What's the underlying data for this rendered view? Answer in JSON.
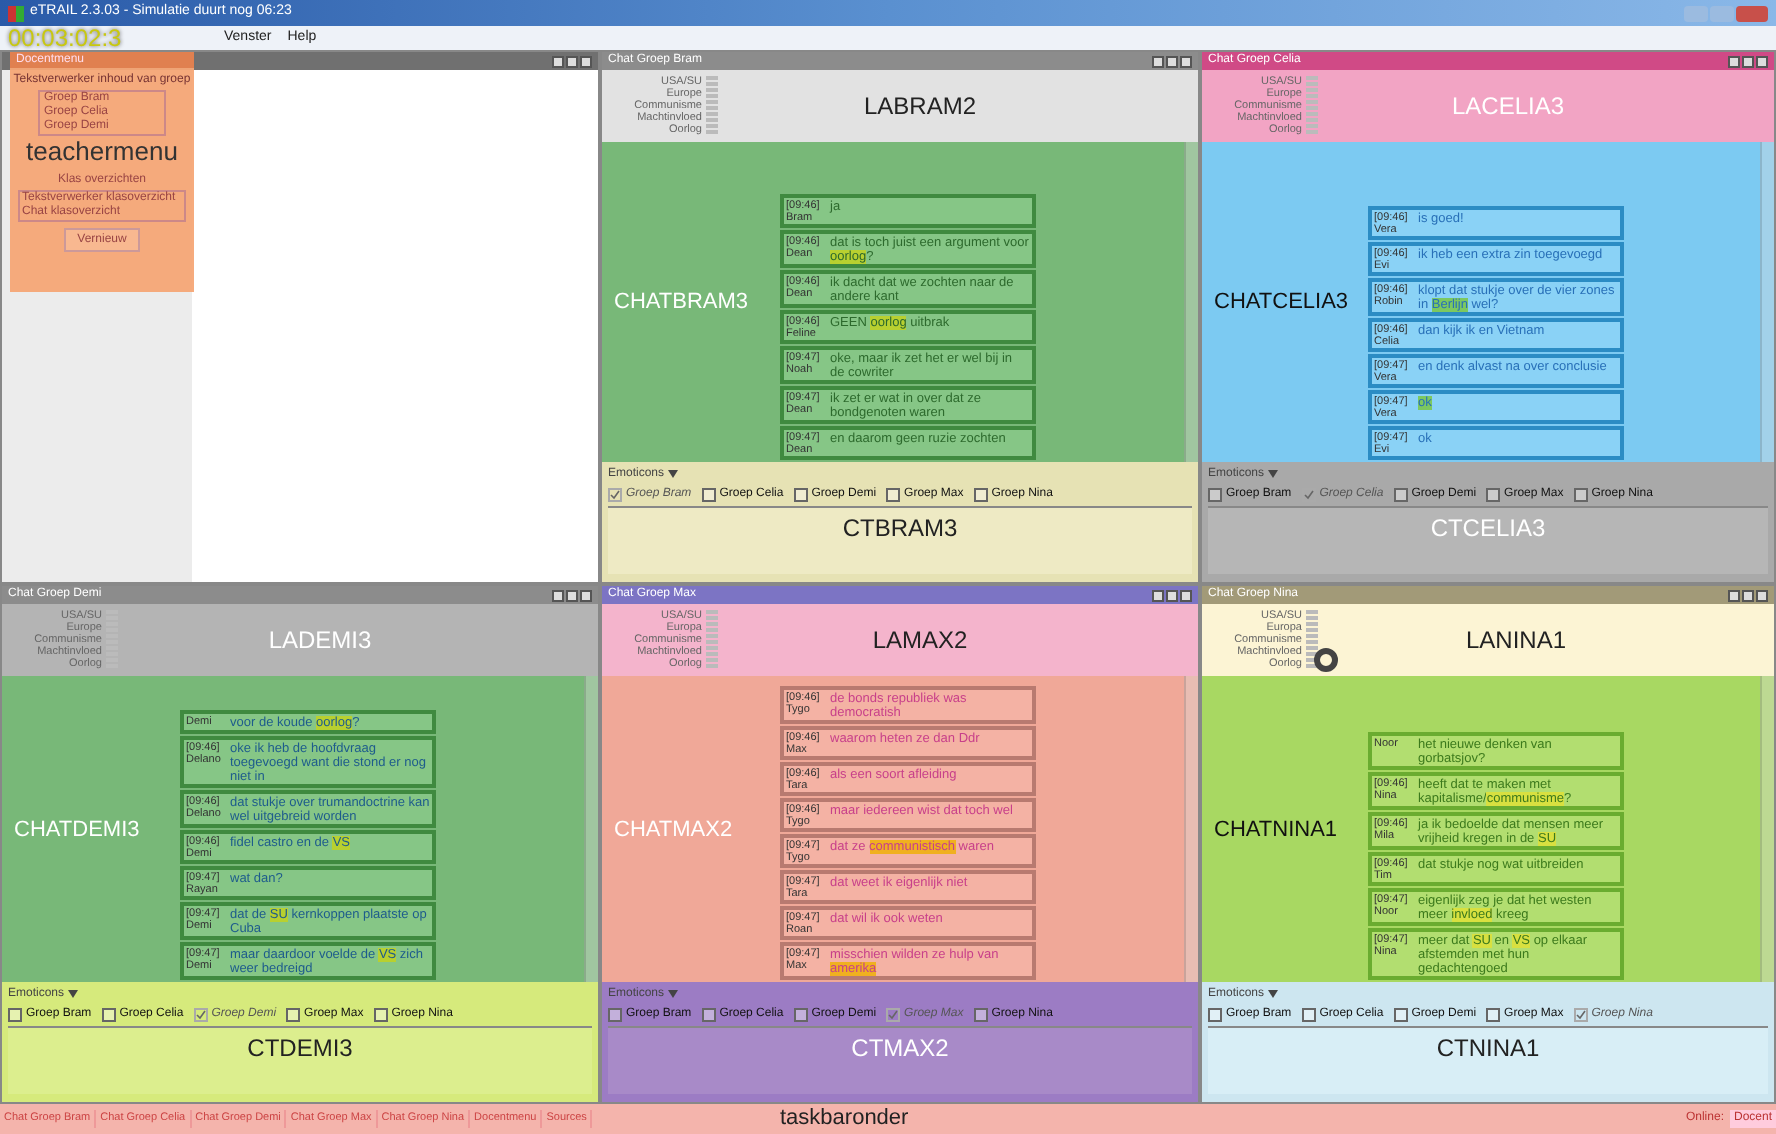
{
  "window": {
    "title": "eTRAIL 2.3.03 - Simulatie duurt nog 06:23"
  },
  "menu": [
    "Venster",
    "Help"
  ],
  "timer": "00:03:02:3",
  "docentmenu": {
    "title": "Docentmenu",
    "section_label": "Tekstverwerker inhoud van groep",
    "groups": [
      {
        "label": "Groep Bram",
        "selected": false
      },
      {
        "label": "Groep Celia",
        "selected": false
      },
      {
        "label": "Groep Demi",
        "selected": false
      }
    ],
    "overlay_label": "teachermenu",
    "overview_label": "Klas overzichten",
    "overviews": [
      {
        "label": "Tekstverwerker klasoverzicht",
        "selected": false
      },
      {
        "label": "Chat klasoverzicht",
        "selected": false
      }
    ],
    "button": "Vernieuw"
  },
  "chats": [
    {
      "title": "Chat Groep Bram",
      "la_label": "LABRAM2",
      "categories": [
        "USA/SU",
        "Europe",
        "Communisme",
        "Machtinvloed",
        "Oorlog"
      ],
      "chat_label": "CHATBRAM3",
      "input_label": "CTBRAM3",
      "emoticons": "Emoticons",
      "messages": [
        {
          "time": "[09:46]",
          "name": "Bram",
          "parts": [
            {
              "text": "ja",
              "highlight": false
            }
          ]
        },
        {
          "time": "[09:46]",
          "name": "Dean",
          "parts": [
            {
              "text": "dat is toch juist een argument voor ",
              "highlight": false
            },
            {
              "text": "oorlog",
              "highlight": true
            },
            {
              "text": "?",
              "highlight": false
            }
          ]
        },
        {
          "time": "[09:46]",
          "name": "Dean",
          "parts": [
            {
              "text": "ik dacht dat we zochten naar de andere kant",
              "highlight": false
            }
          ]
        },
        {
          "time": "[09:46]",
          "name": "Feline",
          "parts": [
            {
              "text": "GEEN ",
              "highlight": false
            },
            {
              "text": "oorlog",
              "highlight": true
            },
            {
              "text": " uitbrak",
              "highlight": false
            }
          ]
        },
        {
          "time": "[09:47]",
          "name": "Noah",
          "parts": [
            {
              "text": "oke, maar ik zet het er wel bij in de cowriter",
              "highlight": false
            }
          ]
        },
        {
          "time": "[09:47]",
          "name": "Dean",
          "parts": [
            {
              "text": "ik zet er wat in over dat ze bondgenoten waren",
              "highlight": false
            }
          ]
        },
        {
          "time": "[09:47]",
          "name": "Dean",
          "parts": [
            {
              "text": "en daarom geen ruzie zochten",
              "highlight": false
            }
          ]
        }
      ],
      "checkboxes": [
        {
          "label": "Groep Bram",
          "checked": true,
          "disabled": true
        },
        {
          "label": "Groep Celia",
          "checked": false,
          "disabled": false
        },
        {
          "label": "Groep Demi",
          "checked": false,
          "disabled": false
        },
        {
          "label": "Groep Max",
          "checked": false,
          "disabled": false
        },
        {
          "label": "Groep Nina",
          "checked": false,
          "disabled": false
        }
      ]
    },
    {
      "title": "Chat Groep Celia",
      "la_label": "LACELIA3",
      "categories": [
        "USA/SU",
        "Europe",
        "Communisme",
        "Machtinvloed",
        "Oorlog"
      ],
      "chat_label": "CHATCELIA3",
      "input_label": "CTCELIA3",
      "emoticons": "Emoticons",
      "messages": [
        {
          "time": "[09:46]",
          "name": "Vera",
          "parts": [
            {
              "text": "is goed!",
              "highlight": false
            }
          ]
        },
        {
          "time": "[09:46]",
          "name": "Evi",
          "parts": [
            {
              "text": "ik heb een extra zin toegevoegd",
              "highlight": false
            }
          ]
        },
        {
          "time": "[09:46]",
          "name": "Robin",
          "parts": [
            {
              "text": "klopt dat stukje over de vier zones in ",
              "highlight": false
            },
            {
              "text": "Berlijn",
              "highlight": true
            },
            {
              "text": " wel?",
              "highlight": false
            }
          ]
        },
        {
          "time": "[09:46]",
          "name": "Celia",
          "parts": [
            {
              "text": "dan kijk ik en Vietnam",
              "highlight": false
            }
          ]
        },
        {
          "time": "[09:47]",
          "name": "Vera",
          "parts": [
            {
              "text": "en denk alvast na over conclusie",
              "highlight": false
            }
          ]
        },
        {
          "time": "[09:47]",
          "name": "Vera",
          "parts": [
            {
              "text": "ok",
              "highlight": true
            }
          ]
        },
        {
          "time": "[09:47]",
          "name": "Evi",
          "parts": [
            {
              "text": "ok",
              "highlight": false
            }
          ]
        }
      ],
      "checkboxes": [
        {
          "label": "Groep Bram",
          "checked": false,
          "disabled": false
        },
        {
          "label": "Groep Celia",
          "checked": true,
          "disabled": true
        },
        {
          "label": "Groep Demi",
          "checked": false,
          "disabled": false
        },
        {
          "label": "Groep Max",
          "checked": false,
          "disabled": false
        },
        {
          "label": "Groep Nina",
          "checked": false,
          "disabled": false
        }
      ]
    },
    {
      "title": "Chat Groep Demi",
      "la_label": "LADEMI3",
      "categories": [
        "USA/SU",
        "Europe",
        "Communisme",
        "Machtinvloed",
        "Oorlog"
      ],
      "chat_label": "CHATDEMI3",
      "input_label": "CTDEMI3",
      "emoticons": "Emoticons",
      "messages": [
        {
          "name": "Demi",
          "parts": [
            {
              "text": "voor de koude ",
              "highlight": false
            },
            {
              "text": "oorlog",
              "highlight": true
            },
            {
              "text": "?",
              "highlight": false
            }
          ]
        },
        {
          "time": "[09:46]",
          "name": "Delano",
          "parts": [
            {
              "text": "oke ik heb de hoofdvraag toegevoegd want die stond er nog niet in",
              "highlight": false
            }
          ]
        },
        {
          "time": "[09:46]",
          "name": "Delano",
          "parts": [
            {
              "text": "dat stukje over trumandoctrine kan wel uitgebreid worden",
              "highlight": false
            }
          ]
        },
        {
          "time": "[09:46]",
          "name": "Demi",
          "parts": [
            {
              "text": "fidel castro en de ",
              "highlight": false
            },
            {
              "text": "VS",
              "highlight": true
            }
          ]
        },
        {
          "time": "[09:47]",
          "name": "Rayan",
          "parts": [
            {
              "text": "wat dan?",
              "highlight": false
            }
          ]
        },
        {
          "time": "[09:47]",
          "name": "Demi",
          "parts": [
            {
              "text": "dat de ",
              "highlight": false
            },
            {
              "text": "SU",
              "highlight": true
            },
            {
              "text": " kernkoppen plaatste op Cuba",
              "highlight": false
            }
          ]
        },
        {
          "time": "[09:47]",
          "name": "Demi",
          "parts": [
            {
              "text": "maar daardoor voelde de ",
              "highlight": false
            },
            {
              "text": "VS",
              "highlight": true
            },
            {
              "text": " zich weer bedreigd",
              "highlight": false
            }
          ]
        }
      ],
      "checkboxes": [
        {
          "label": "Groep Bram",
          "checked": false,
          "disabled": false
        },
        {
          "label": "Groep Celia",
          "checked": false,
          "disabled": false
        },
        {
          "label": "Groep Demi",
          "checked": true,
          "disabled": true
        },
        {
          "label": "Groep Max",
          "checked": false,
          "disabled": false
        },
        {
          "label": "Groep Nina",
          "checked": false,
          "disabled": false
        }
      ]
    },
    {
      "title": "Chat Groep Max",
      "la_label": "LAMAX2",
      "categories": [
        "USA/SU",
        "Europa",
        "Communisme",
        "Machtinvloed",
        "Oorlog"
      ],
      "chat_label": "CHATMAX2",
      "input_label": "CTMAX2",
      "emoticons": "Emoticons",
      "messages": [
        {
          "time": "[09:46]",
          "name": "Tygo",
          "parts": [
            {
              "text": "de bonds republiek was democratish",
              "highlight": false
            }
          ]
        },
        {
          "time": "[09:46]",
          "name": "Max",
          "parts": [
            {
              "text": "waarom heten ze dan Ddr",
              "highlight": false
            }
          ]
        },
        {
          "time": "[09:46]",
          "name": "Tara",
          "parts": [
            {
              "text": "als een soort afleiding",
              "highlight": false
            }
          ]
        },
        {
          "time": "[09:46]",
          "name": "Tygo",
          "parts": [
            {
              "text": "maar iedereen wist dat toch wel",
              "highlight": false
            }
          ]
        },
        {
          "time": "[09:47]",
          "name": "Tygo",
          "parts": [
            {
              "text": "dat ze ",
              "highlight": false
            },
            {
              "text": "communistisch",
              "highlight": true
            },
            {
              "text": " waren",
              "highlight": false
            }
          ]
        },
        {
          "time": "[09:47]",
          "name": "Tara",
          "parts": [
            {
              "text": "dat weet ik eigenlijk niet",
              "highlight": false
            }
          ]
        },
        {
          "time": "[09:47]",
          "name": "Roan",
          "parts": [
            {
              "text": "dat wil ik ook weten",
              "highlight": false
            }
          ]
        },
        {
          "time": "[09:47]",
          "name": "Max",
          "parts": [
            {
              "text": "misschien wilden ze hulp van ",
              "highlight": false
            },
            {
              "text": "amerika",
              "highlight": true
            }
          ]
        }
      ],
      "checkboxes": [
        {
          "label": "Groep Bram",
          "checked": false,
          "disabled": false
        },
        {
          "label": "Groep Celia",
          "checked": false,
          "disabled": false
        },
        {
          "label": "Groep Demi",
          "checked": false,
          "disabled": false
        },
        {
          "label": "Groep Max",
          "checked": true,
          "disabled": true
        },
        {
          "label": "Groep Nina",
          "checked": false,
          "disabled": false
        }
      ]
    },
    {
      "title": "Chat Groep Nina",
      "la_label": "LANINA1",
      "categories": [
        "USA/SU",
        "Europa",
        "Communisme",
        "Machtinvloed",
        "Oorlog"
      ],
      "chat_label": "CHATNINA1",
      "input_label": "CTNINA1",
      "emoticons": "Emoticons",
      "messages": [
        {
          "name": "Noor",
          "parts": [
            {
              "text": "het nieuwe denken van gorbatsjov?",
              "highlight": false
            }
          ]
        },
        {
          "time": "[09:46]",
          "name": "Nina",
          "parts": [
            {
              "text": "heeft dat te maken met kapitalisme/",
              "highlight": false
            },
            {
              "text": "communisme",
              "highlight": true
            },
            {
              "text": "?",
              "highlight": false
            }
          ]
        },
        {
          "time": "[09:46]",
          "name": "Mila",
          "parts": [
            {
              "text": "ja ik bedoelde dat mensen meer vrijheid kregen in de ",
              "highlight": false
            },
            {
              "text": "SU",
              "highlight": true
            }
          ]
        },
        {
          "time": "[09:46]",
          "name": "Tim",
          "parts": [
            {
              "text": "dat stukje nog wat uitbreiden",
              "highlight": false
            }
          ]
        },
        {
          "time": "[09:47]",
          "name": "Noor",
          "parts": [
            {
              "text": "eigenlijk zeg je dat het westen meer ",
              "highlight": false
            },
            {
              "text": "invloed",
              "highlight": true
            },
            {
              "text": " kreeg",
              "highlight": false
            }
          ]
        },
        {
          "time": "[09:47]",
          "name": "Nina",
          "parts": [
            {
              "text": "meer dat ",
              "highlight": false
            },
            {
              "text": "SU",
              "highlight": true
            },
            {
              "text": " en ",
              "highlight": false
            },
            {
              "text": "VS",
              "highlight": true
            },
            {
              "text": " op elkaar afstemden met hun gedachtengoed",
              "highlight": false
            }
          ]
        }
      ],
      "checkboxes": [
        {
          "label": "Groep Bram",
          "checked": false,
          "disabled": false
        },
        {
          "label": "Groep Celia",
          "checked": false,
          "disabled": false
        },
        {
          "label": "Groep Demi",
          "checked": false,
          "disabled": false
        },
        {
          "label": "Groep Max",
          "checked": false,
          "disabled": false
        },
        {
          "label": "Groep Nina",
          "checked": true,
          "disabled": true
        }
      ]
    }
  ],
  "taskbar": {
    "items": [
      "Chat Groep Bram",
      "Chat Groep Celia",
      "Chat Groep Demi",
      "Chat Groep Max",
      "Chat Groep Nina",
      "Docentmenu",
      "Sources"
    ],
    "label": "taskbaronder",
    "status_label": "Online:",
    "status_value": "Docent"
  }
}
